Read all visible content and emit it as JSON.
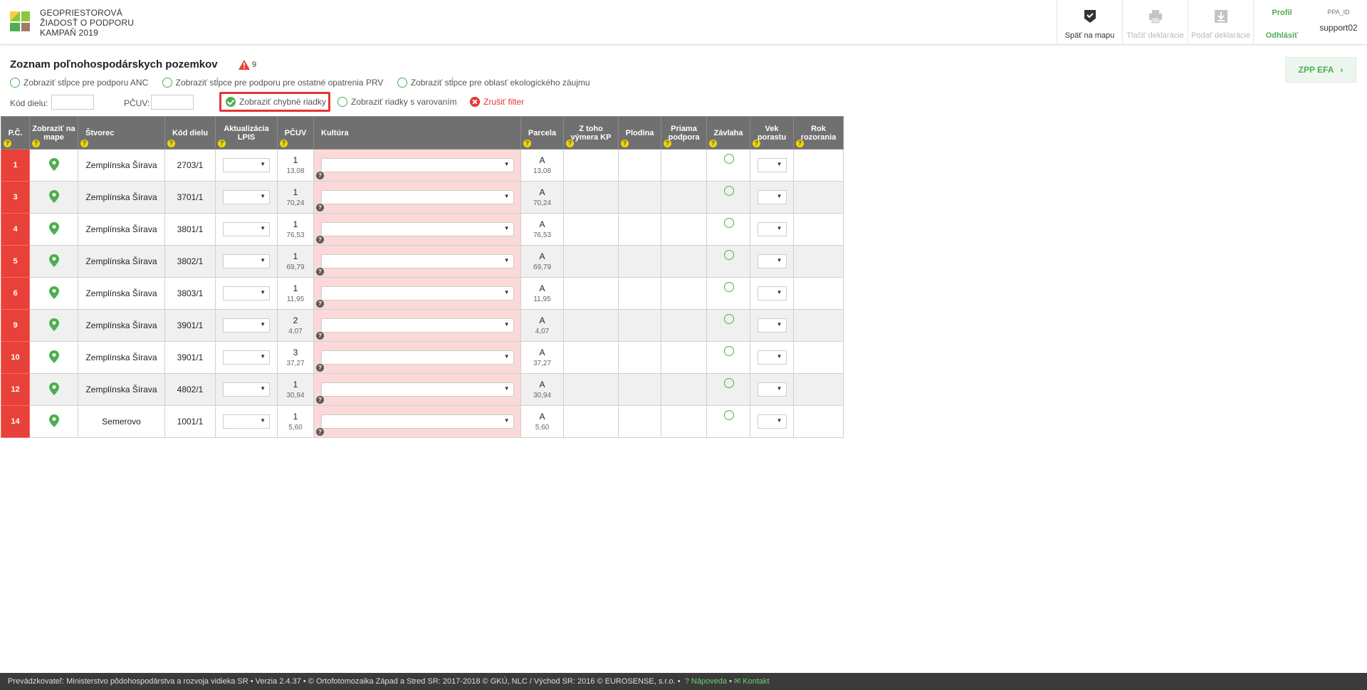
{
  "app": {
    "title_line1": "GEOPRIESTOROVÁ",
    "title_line2": "ŽIADOSŤ O PODPORU",
    "title_line3": "KAMPAŇ 2019"
  },
  "header": {
    "back_label": "Späť na mapu",
    "print_label": "Tlačiť deklarácie",
    "submit_label": "Podať deklarácie",
    "profile_label": "Profil",
    "logout_label": "Odhlásiť",
    "user_id_label": "PPA_ID",
    "username": "support02"
  },
  "page": {
    "title": "Zoznam poľnohospodárskych pozemkov",
    "warning_count": "9",
    "zpp_button": "ZPP EFA"
  },
  "toggles": [
    "Zobraziť stĺpce pre podporu ANC",
    "Zobraziť stĺpce pre podporu pre ostatné opatrenia PRV",
    "Zobraziť stĺpce pre oblasť ekologického záujmu"
  ],
  "filters": {
    "kod_dielu_label": "Kód dielu:",
    "pcuv_label": "PČUV:",
    "error_rows_label": "Zobraziť chybné riadky",
    "warning_rows_label": "Zobraziť riadky s varovaním",
    "clear_label": "Zrušiť filter"
  },
  "table": {
    "headers": {
      "pc": "P.Č.",
      "map": "Zobraziť na mape",
      "stvorec": "Štvorec",
      "kod_dielu": "Kód dielu",
      "lpis": "Aktualizácia LPIS",
      "pcuv": "PČUV",
      "kultura": "Kultúra",
      "parcela": "Parcela",
      "vymera_kp": "Z toho výmera KP",
      "plodina": "Plodina",
      "priama": "Priama podpora",
      "zavlaha": "Závlaha",
      "vek": "Vek porastu",
      "rok": "Rok rozorania"
    },
    "rows": [
      {
        "pc": "1",
        "stvorec": "Zemplínska Šírava",
        "kod": "2703/1",
        "pcuv": "1",
        "pcuv_area": "13,08",
        "parcela": "A",
        "parcela_area": "13,08"
      },
      {
        "pc": "3",
        "stvorec": "Zemplínska Šírava",
        "kod": "3701/1",
        "pcuv": "1",
        "pcuv_area": "70,24",
        "parcela": "A",
        "parcela_area": "70,24"
      },
      {
        "pc": "4",
        "stvorec": "Zemplínska Šírava",
        "kod": "3801/1",
        "pcuv": "1",
        "pcuv_area": "76,53",
        "parcela": "A",
        "parcela_area": "76,53"
      },
      {
        "pc": "5",
        "stvorec": "Zemplínska Šírava",
        "kod": "3802/1",
        "pcuv": "1",
        "pcuv_area": "69,79",
        "parcela": "A",
        "parcela_area": "69,79"
      },
      {
        "pc": "6",
        "stvorec": "Zemplínska Šírava",
        "kod": "3803/1",
        "pcuv": "1",
        "pcuv_area": "11,95",
        "parcela": "A",
        "parcela_area": "11,95"
      },
      {
        "pc": "9",
        "stvorec": "Zemplínska Šírava",
        "kod": "3901/1",
        "pcuv": "2",
        "pcuv_area": "4,07",
        "parcela": "A",
        "parcela_area": "4,07"
      },
      {
        "pc": "10",
        "stvorec": "Zemplínska Šírava",
        "kod": "3901/1",
        "pcuv": "3",
        "pcuv_area": "37,27",
        "parcela": "A",
        "parcela_area": "37,27"
      },
      {
        "pc": "12",
        "stvorec": "Zemplínska Šírava",
        "kod": "4802/1",
        "pcuv": "1",
        "pcuv_area": "30,94",
        "parcela": "A",
        "parcela_area": "30,94"
      },
      {
        "pc": "14",
        "stvorec": "Semerovo",
        "kod": "1001/1",
        "pcuv": "1",
        "pcuv_area": "5,60",
        "parcela": "A",
        "parcela_area": "5,60"
      }
    ]
  },
  "footer": {
    "text": "Prevádzkovateľ: Ministerstvo pôdohospodárstva a rozvoja vidieka SR • Verzia 2.4.37 • © Ortofotomozaika Západ a Stred SR: 2017-2018 © GKÚ, NLC / Východ SR: 2016 © EUROSENSE, s.r.o. •",
    "help_label": "Nápoveda",
    "contact_label": "Kontakt"
  },
  "colors": {
    "accent_green": "#4caf50",
    "error_red": "#e8413a",
    "header_gray": "#707070",
    "kultura_pink": "#fad9d8"
  }
}
